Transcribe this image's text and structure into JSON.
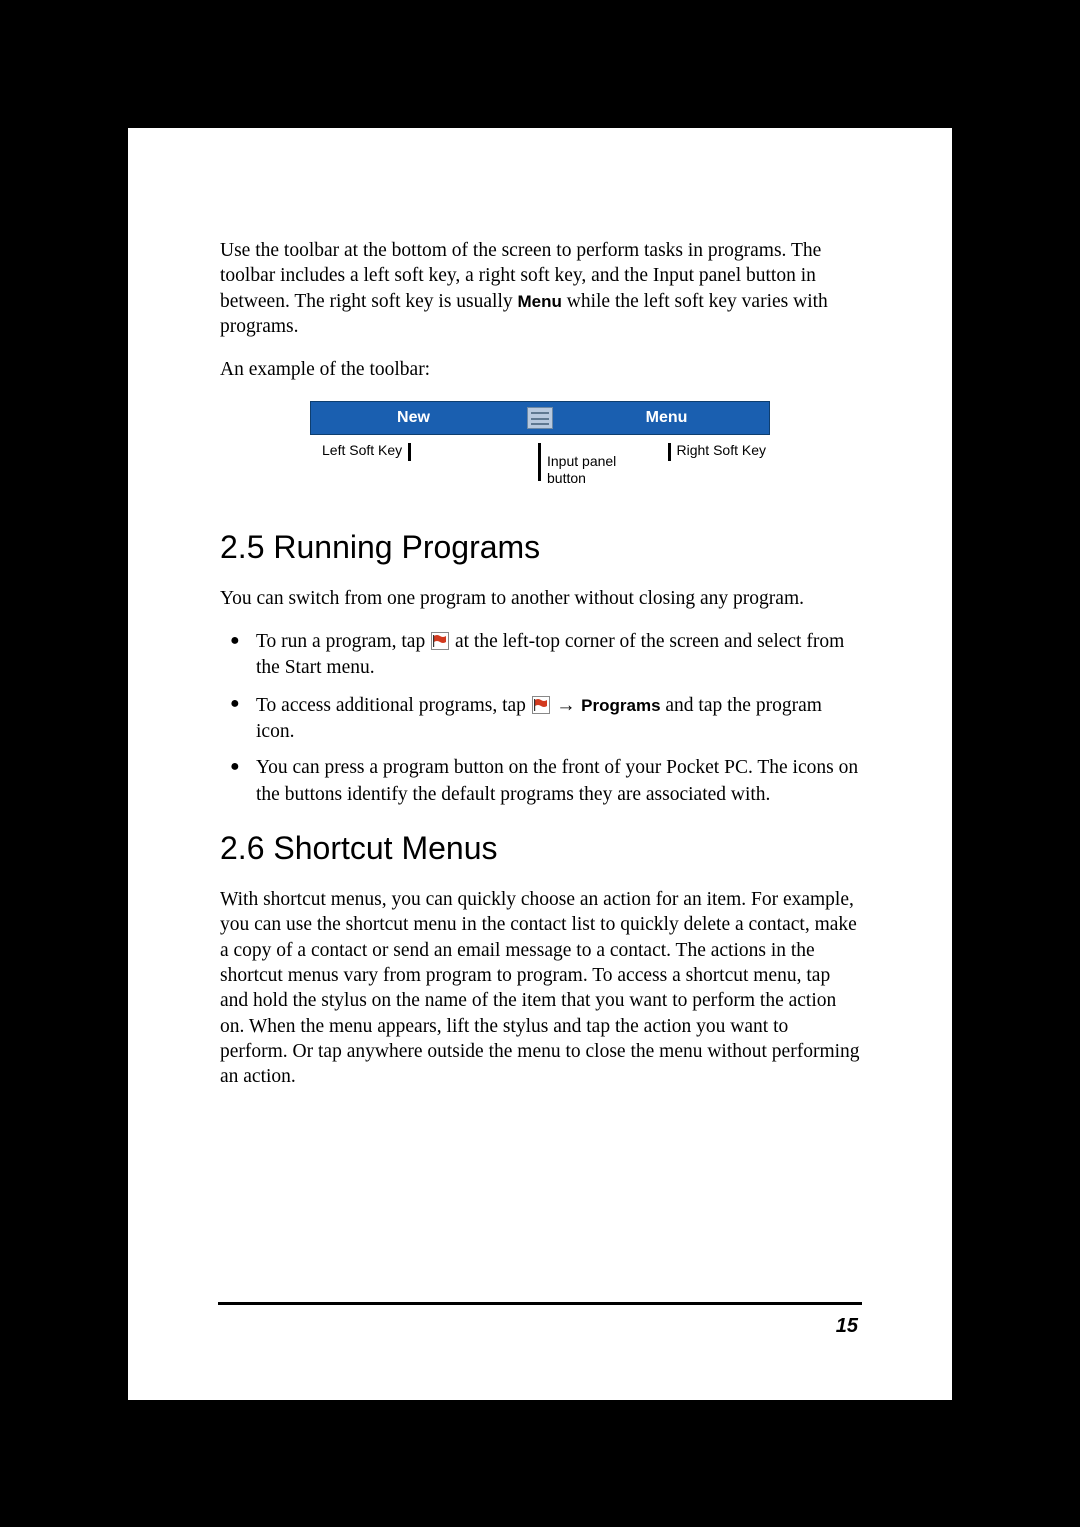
{
  "para1_a": "Use the toolbar at the bottom of the screen to perform tasks in programs. The toolbar includes a left soft key, a right soft key, and the Input panel button in between. The right soft key is usually ",
  "para1_menu": "Menu",
  "para1_b": " while the left soft key varies with programs.",
  "para2": "An example of the toolbar:",
  "toolbar": {
    "new": "New",
    "menu": "Menu",
    "left_soft_key": "Left Soft Key",
    "right_soft_key": "Right Soft Key",
    "input_panel_line1": "Input panel",
    "input_panel_line2": "button"
  },
  "section_25": "2.5   Running Programs",
  "para3": "You can switch from one program to another without closing any program.",
  "bullet1_a": "To run a program, tap ",
  "bullet1_b": " at the left-top corner of the screen and select from the Start menu.",
  "bullet2_a": "To access additional programs, tap ",
  "bullet2_arrow": " → ",
  "bullet2_programs": "Programs",
  "bullet2_b": " and tap the program icon.",
  "bullet3": "You can press a program button on the front of your Pocket PC. The icons on the buttons identify the default programs they are associated with.",
  "section_26": "2.6   Shortcut Menus",
  "para4": "With shortcut menus, you can quickly choose an action for an item. For example, you can use the shortcut menu in the contact list to quickly delete a contact, make a copy of a contact or send an email message to a contact. The actions in the shortcut menus vary from program to program. To access a shortcut menu, tap and hold the stylus on the name of the item that you want to perform the action on. When the menu appears, lift the stylus and tap the action you want to perform. Or tap anywhere outside the menu to close the menu without performing an action.",
  "page_number": "15"
}
